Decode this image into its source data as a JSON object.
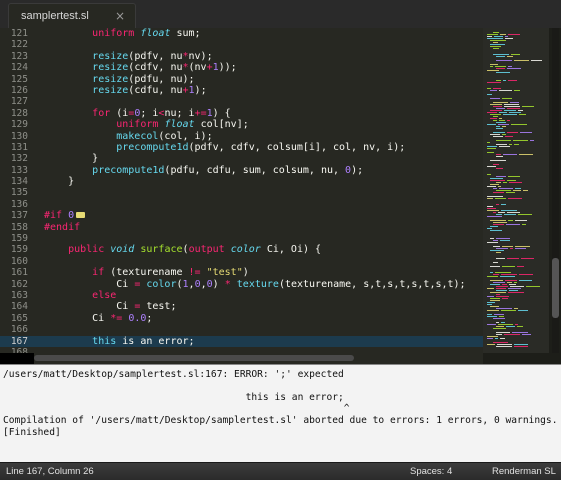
{
  "tab": {
    "title": "samplertest.sl",
    "close": "×"
  },
  "editor": {
    "lines": [
      {
        "n": "121",
        "active": false,
        "t": [
          [
            "        ",
            "pl"
          ],
          [
            "uniform",
            "kw"
          ],
          [
            " ",
            "pl"
          ],
          [
            "float",
            "ty"
          ],
          [
            " sum;",
            "pl"
          ]
        ]
      },
      {
        "n": "122",
        "active": false,
        "t": []
      },
      {
        "n": "123",
        "active": false,
        "t": [
          [
            "        ",
            "pl"
          ],
          [
            "resize",
            "fn"
          ],
          [
            "(pdfv, nu",
            "pl"
          ],
          [
            "*",
            "kw"
          ],
          [
            "nv);",
            "pl"
          ]
        ]
      },
      {
        "n": "124",
        "active": false,
        "t": [
          [
            "        ",
            "pl"
          ],
          [
            "resize",
            "fn"
          ],
          [
            "(cdfv, nu",
            "pl"
          ],
          [
            "*",
            "kw"
          ],
          [
            "(nv",
            "pl"
          ],
          [
            "+",
            "kw"
          ],
          [
            "1",
            "nm"
          ],
          [
            "));",
            "pl"
          ]
        ]
      },
      {
        "n": "125",
        "active": false,
        "t": [
          [
            "        ",
            "pl"
          ],
          [
            "resize",
            "fn"
          ],
          [
            "(pdfu, nu);",
            "pl"
          ]
        ]
      },
      {
        "n": "126",
        "active": false,
        "t": [
          [
            "        ",
            "pl"
          ],
          [
            "resize",
            "fn"
          ],
          [
            "(cdfu, nu",
            "pl"
          ],
          [
            "+",
            "kw"
          ],
          [
            "1",
            "nm"
          ],
          [
            ");",
            "pl"
          ]
        ]
      },
      {
        "n": "127",
        "active": false,
        "t": []
      },
      {
        "n": "128",
        "active": false,
        "t": [
          [
            "        ",
            "pl"
          ],
          [
            "for",
            "kw"
          ],
          [
            " (i",
            "pl"
          ],
          [
            "=",
            "kw"
          ],
          [
            "0",
            "nm"
          ],
          [
            "; i",
            "pl"
          ],
          [
            "<",
            "kw"
          ],
          [
            "nu; i",
            "pl"
          ],
          [
            "+=",
            "kw"
          ],
          [
            "1",
            "nm"
          ],
          [
            ") {",
            "pl"
          ]
        ]
      },
      {
        "n": "129",
        "active": false,
        "t": [
          [
            "            ",
            "pl"
          ],
          [
            "uniform",
            "kw"
          ],
          [
            " ",
            "pl"
          ],
          [
            "float",
            "ty"
          ],
          [
            " col[nv];",
            "pl"
          ]
        ]
      },
      {
        "n": "130",
        "active": false,
        "t": [
          [
            "            ",
            "pl"
          ],
          [
            "makecol",
            "fn"
          ],
          [
            "(col, i);",
            "pl"
          ]
        ]
      },
      {
        "n": "131",
        "active": false,
        "t": [
          [
            "            ",
            "pl"
          ],
          [
            "precompute1d",
            "fn"
          ],
          [
            "(pdfv, cdfv, colsum[i], col, nv, i);",
            "pl"
          ]
        ]
      },
      {
        "n": "132",
        "active": false,
        "t": [
          [
            "        }",
            "pl"
          ]
        ]
      },
      {
        "n": "133",
        "active": false,
        "t": [
          [
            "        ",
            "pl"
          ],
          [
            "precompute1d",
            "fn"
          ],
          [
            "(pdfu, cdfu, sum, colsum, nu, ",
            "pl"
          ],
          [
            "0",
            "nm"
          ],
          [
            ");",
            "pl"
          ]
        ]
      },
      {
        "n": "134",
        "active": false,
        "t": [
          [
            "    }",
            "pl"
          ]
        ]
      },
      {
        "n": "135",
        "active": false,
        "t": []
      },
      {
        "n": "136",
        "active": false,
        "t": []
      },
      {
        "n": "137",
        "active": false,
        "fold": true,
        "t": [
          [
            "#if",
            "kw"
          ],
          [
            " ",
            "pl"
          ],
          [
            "0",
            "nm"
          ]
        ]
      },
      {
        "n": "158",
        "active": false,
        "t": [
          [
            "#endif",
            "kw"
          ]
        ]
      },
      {
        "n": "159",
        "active": false,
        "t": []
      },
      {
        "n": "159",
        "active": false,
        "t": [
          [
            "    ",
            "pl"
          ],
          [
            "public",
            "kw"
          ],
          [
            " ",
            "pl"
          ],
          [
            "void",
            "ty"
          ],
          [
            " ",
            "pl"
          ],
          [
            "surface",
            "gr"
          ],
          [
            "(",
            "pl"
          ],
          [
            "output",
            "kw"
          ],
          [
            " ",
            "pl"
          ],
          [
            "color",
            "ty"
          ],
          [
            " Ci, Oi) {",
            "pl"
          ]
        ]
      },
      {
        "n": "160",
        "active": false,
        "t": []
      },
      {
        "n": "161",
        "active": false,
        "t": [
          [
            "        ",
            "pl"
          ],
          [
            "if",
            "kw"
          ],
          [
            " (texturename ",
            "pl"
          ],
          [
            "!=",
            "kw"
          ],
          [
            " ",
            "pl"
          ],
          [
            "\"test\"",
            "st"
          ],
          [
            ")",
            "pl"
          ]
        ]
      },
      {
        "n": "162",
        "active": false,
        "t": [
          [
            "            Ci ",
            "pl"
          ],
          [
            "=",
            "kw"
          ],
          [
            " ",
            "pl"
          ],
          [
            "color",
            "fn"
          ],
          [
            "(",
            "pl"
          ],
          [
            "1",
            "nm"
          ],
          [
            ",",
            "pl"
          ],
          [
            "0",
            "nm"
          ],
          [
            ",",
            "pl"
          ],
          [
            "0",
            "nm"
          ],
          [
            ") ",
            "pl"
          ],
          [
            "*",
            "kw"
          ],
          [
            " ",
            "pl"
          ],
          [
            "texture",
            "fn"
          ],
          [
            "(texturename, s,t,s,t,s,t,s,t);",
            "pl"
          ]
        ]
      },
      {
        "n": "163",
        "active": false,
        "t": [
          [
            "        ",
            "pl"
          ],
          [
            "else",
            "kw"
          ]
        ]
      },
      {
        "n": "164",
        "active": false,
        "t": [
          [
            "            Ci ",
            "pl"
          ],
          [
            "=",
            "kw"
          ],
          [
            " test;",
            "pl"
          ]
        ]
      },
      {
        "n": "165",
        "active": false,
        "t": [
          [
            "        Ci ",
            "pl"
          ],
          [
            "*=",
            "kw"
          ],
          [
            " ",
            "pl"
          ],
          [
            "0.0",
            "nm"
          ],
          [
            ";",
            "pl"
          ]
        ]
      },
      {
        "n": "166",
        "active": false,
        "t": []
      },
      {
        "n": "167",
        "active": true,
        "t": [
          [
            "        ",
            "pl"
          ],
          [
            "this",
            "fn"
          ],
          [
            " is an error;",
            "pl"
          ]
        ]
      },
      {
        "n": "168",
        "active": false,
        "t": []
      }
    ]
  },
  "output": {
    "lines": [
      "/users/matt/Desktop/samplertest.sl:167: ERROR: ';' expected",
      "",
      "                                          this is an error;",
      "                                                           ^",
      "Compilation of '/users/matt/Desktop/samplertest.sl' aborted due to errors: 1 errors, 0 warnings.",
      "[Finished]"
    ]
  },
  "status": {
    "position": "Line 167, Column 26",
    "spaces": "Spaces: 4",
    "syntax": "Renderman SL"
  },
  "colors": {
    "background": "#272822",
    "keyword": "#f92672",
    "function": "#66d9ef",
    "number": "#ae81ff",
    "string": "#e6db74",
    "highlight": "#1c3b4e"
  }
}
